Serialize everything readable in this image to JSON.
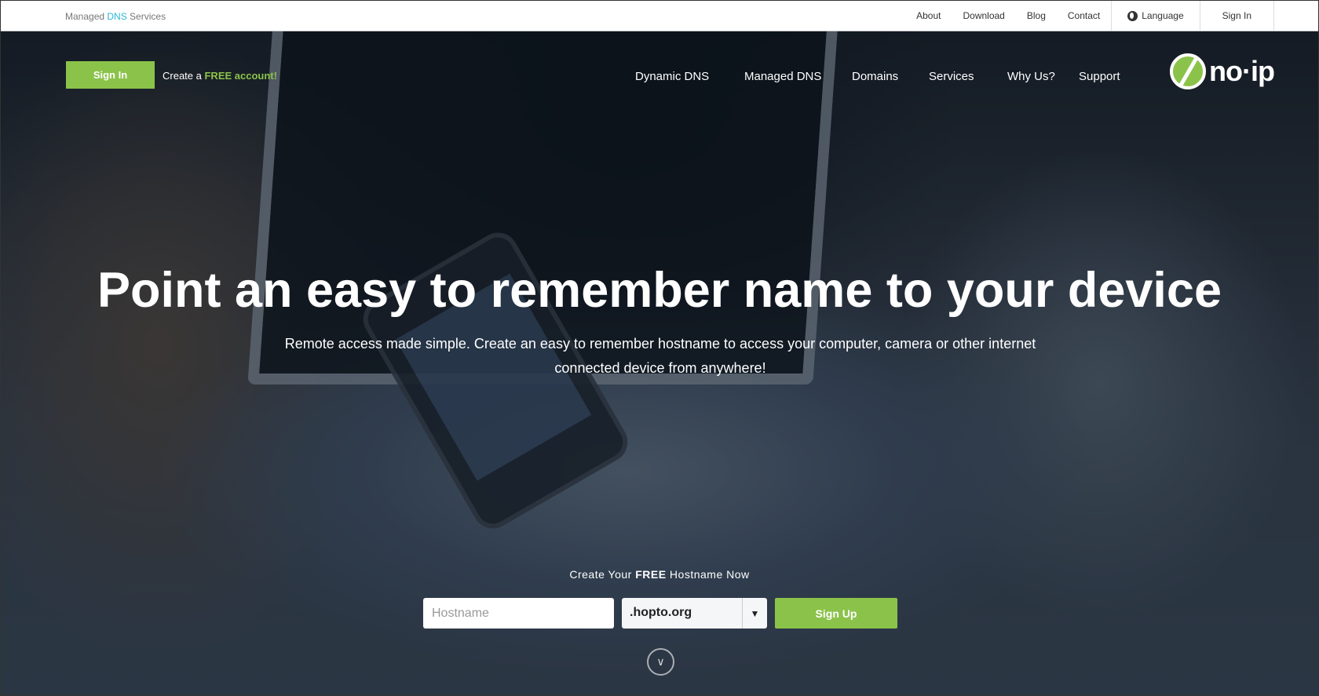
{
  "topbar": {
    "tagline_pre": "Managed ",
    "tagline_dns": "DNS",
    "tagline_post": " Services",
    "links": [
      "About",
      "Download",
      "Blog",
      "Contact"
    ],
    "language": "Language",
    "sign_in": "Sign In"
  },
  "header": {
    "sign_in": "Sign In",
    "create_pre": "Create a ",
    "create_free": "FREE account!",
    "nav": [
      "Dynamic DNS",
      "Managed DNS",
      "Domains",
      "Services",
      "Why Us?",
      "Support"
    ],
    "logo": "no-ip"
  },
  "hero": {
    "title": "Point an easy to remember name to your device",
    "subtitle": "Remote access made simple. Create an easy to remember hostname to access your computer, camera or other internet connected device from anywhere!",
    "cta_pre": "Create Your ",
    "cta_free": "FREE",
    "cta_post": " Hostname Now",
    "hostname_placeholder": "Hostname",
    "domain_selected": ".hopto.org",
    "signup": "Sign Up"
  },
  "colors": {
    "accent": "#8bc34a",
    "dns": "#2bb5d8"
  },
  "icons": {
    "language": "globe-icon",
    "dropdown": "chevron-down-icon",
    "scroll": "circle-chevron-down-icon"
  }
}
